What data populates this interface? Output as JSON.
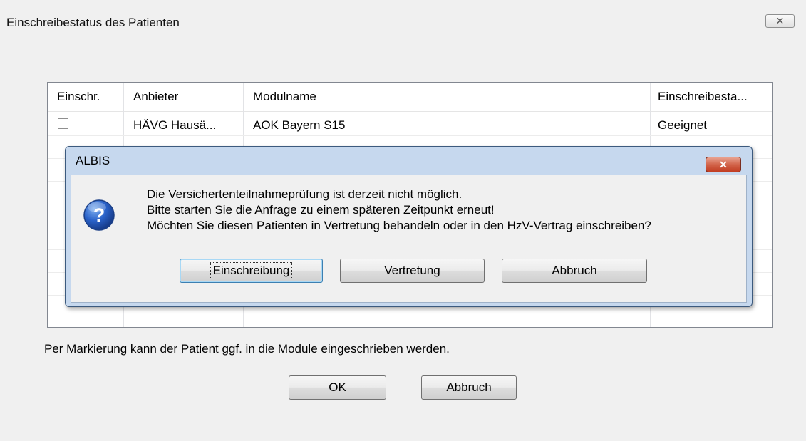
{
  "main_window": {
    "title": "Einschreibestatus des Patienten",
    "close_label": "✕"
  },
  "table": {
    "columns": [
      "Einschr.",
      "Anbieter",
      "Modulname",
      "Einschreibesta..."
    ],
    "rows": [
      {
        "checked": false,
        "anbieter": "HÄVG Hausä...",
        "modulname": "AOK Bayern S15",
        "status": "Geeignet"
      }
    ]
  },
  "hint": "Per Markierung kann der Patient ggf. in die Module eingeschrieben werden.",
  "footer": {
    "ok_label": "OK",
    "cancel_label": "Abbruch"
  },
  "dialog": {
    "title": "ALBIS",
    "close_label": "✕",
    "icon": "question-icon",
    "message_lines": [
      "Die Versichertenteilnahmeprüfung ist derzeit nicht möglich.",
      "Bitte starten Sie die Anfrage zu einem späteren Zeitpunkt erneut!",
      "Möchten Sie diesen Patienten in Vertretung behandeln oder in den HzV-Vertrag einschreiben?"
    ],
    "buttons": {
      "einschreibung": "Einschreibung",
      "vertretung": "Vertretung",
      "abbruch": "Abbruch"
    }
  },
  "colors": {
    "dialog_frame": "#c6d8ee",
    "close_red": "#c13c21",
    "window_bg": "#f0f0f0"
  }
}
